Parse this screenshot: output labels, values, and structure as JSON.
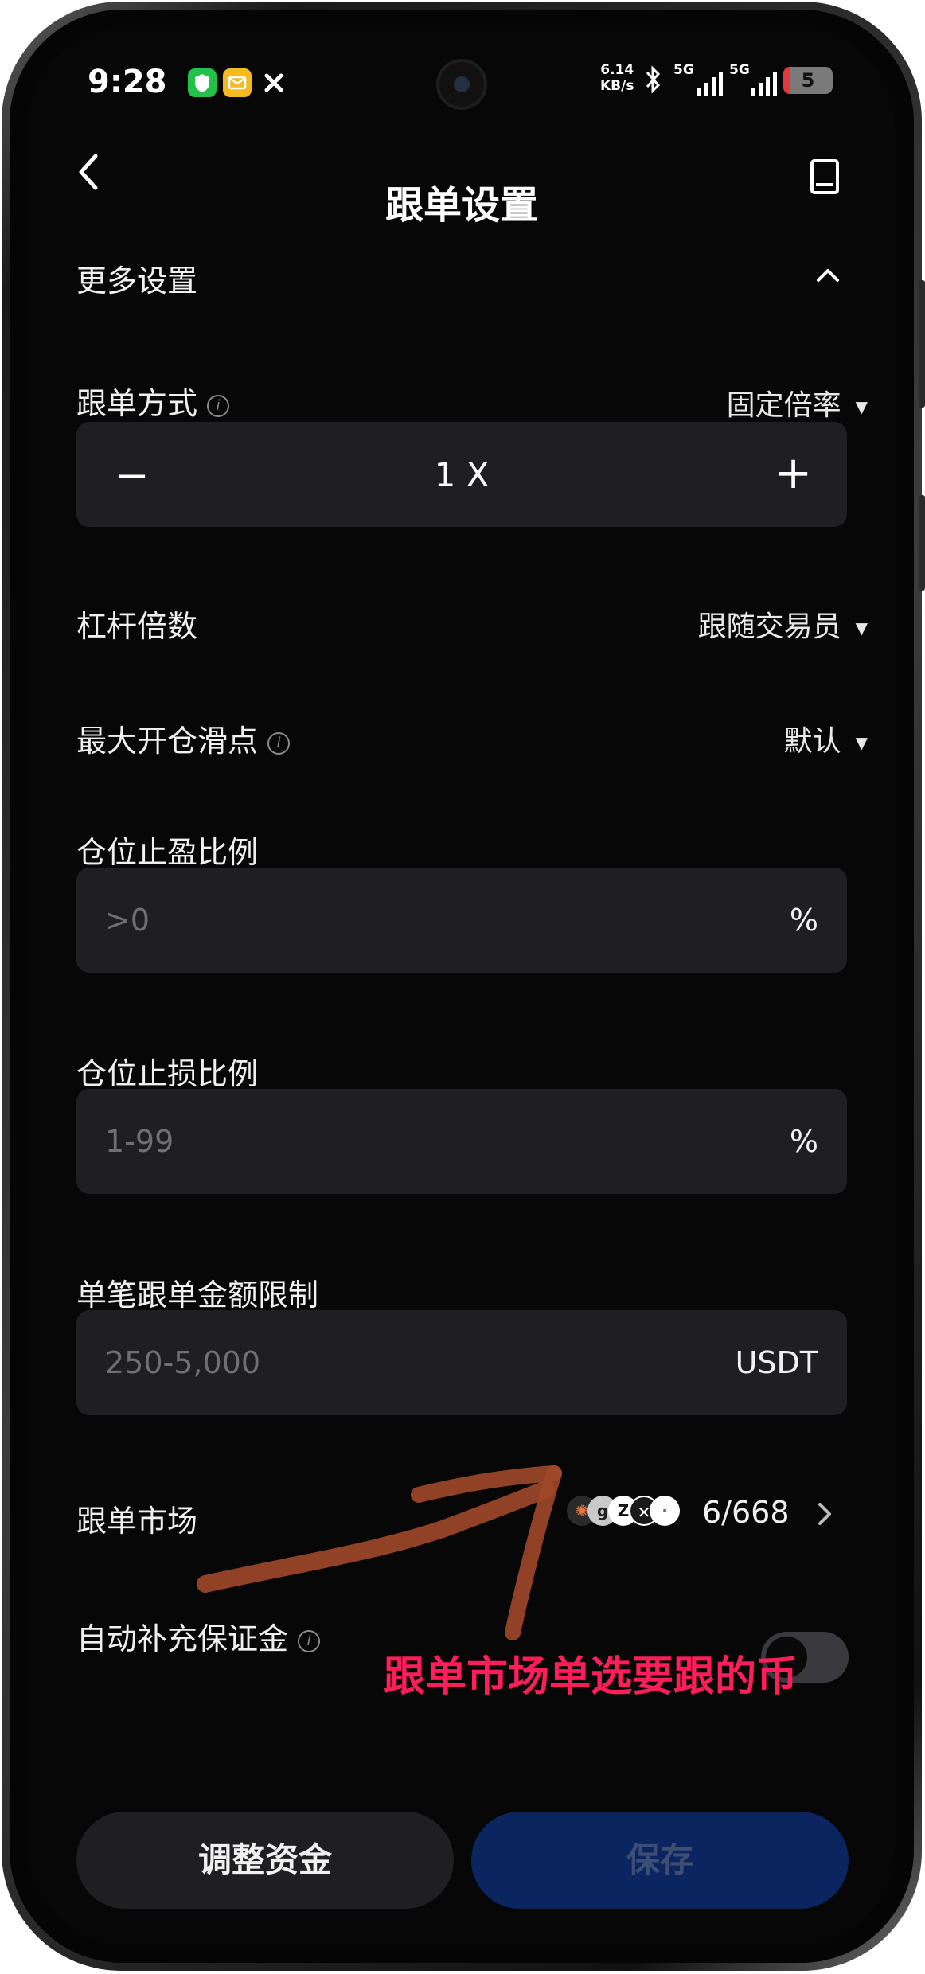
{
  "status_bar": {
    "time": "9:28",
    "net_speed_value": "6.14",
    "net_speed_unit": "KB/s",
    "signal_1": "5G",
    "signal_2": "5G",
    "battery": "5"
  },
  "header": {
    "title": "跟单设置",
    "back_icon": "chevron-left-icon",
    "doc_icon": "book-icon"
  },
  "more_settings": {
    "label": "更多设置",
    "state": "expanded"
  },
  "copy_mode": {
    "label": "跟单方式",
    "value": "固定倍率",
    "multiplier": "1 X",
    "minus": "−",
    "plus": "+"
  },
  "leverage": {
    "label": "杠杆倍数",
    "value": "跟随交易员"
  },
  "max_slippage": {
    "label": "最大开仓滑点",
    "value": "默认"
  },
  "take_profit": {
    "label": "仓位止盈比例",
    "placeholder": ">0",
    "unit": "%"
  },
  "stop_loss": {
    "label": "仓位止损比例",
    "placeholder": "1-99",
    "unit": "%"
  },
  "amount_limit": {
    "label": "单笔跟单金额限制",
    "placeholder": "250-5,000",
    "unit": "USDT"
  },
  "market": {
    "label": "跟单市场",
    "count": "6/668"
  },
  "auto_margin": {
    "label": "自动补充保证金",
    "enabled": false
  },
  "annotation": {
    "text": "跟单市场单选要跟的币",
    "color": "#ff1e5a"
  },
  "buttons": {
    "adjust": "调整资金",
    "save": "保存"
  },
  "colors": {
    "background": "#070707",
    "field": "#1f1f22",
    "save_button": "#0a2560"
  }
}
